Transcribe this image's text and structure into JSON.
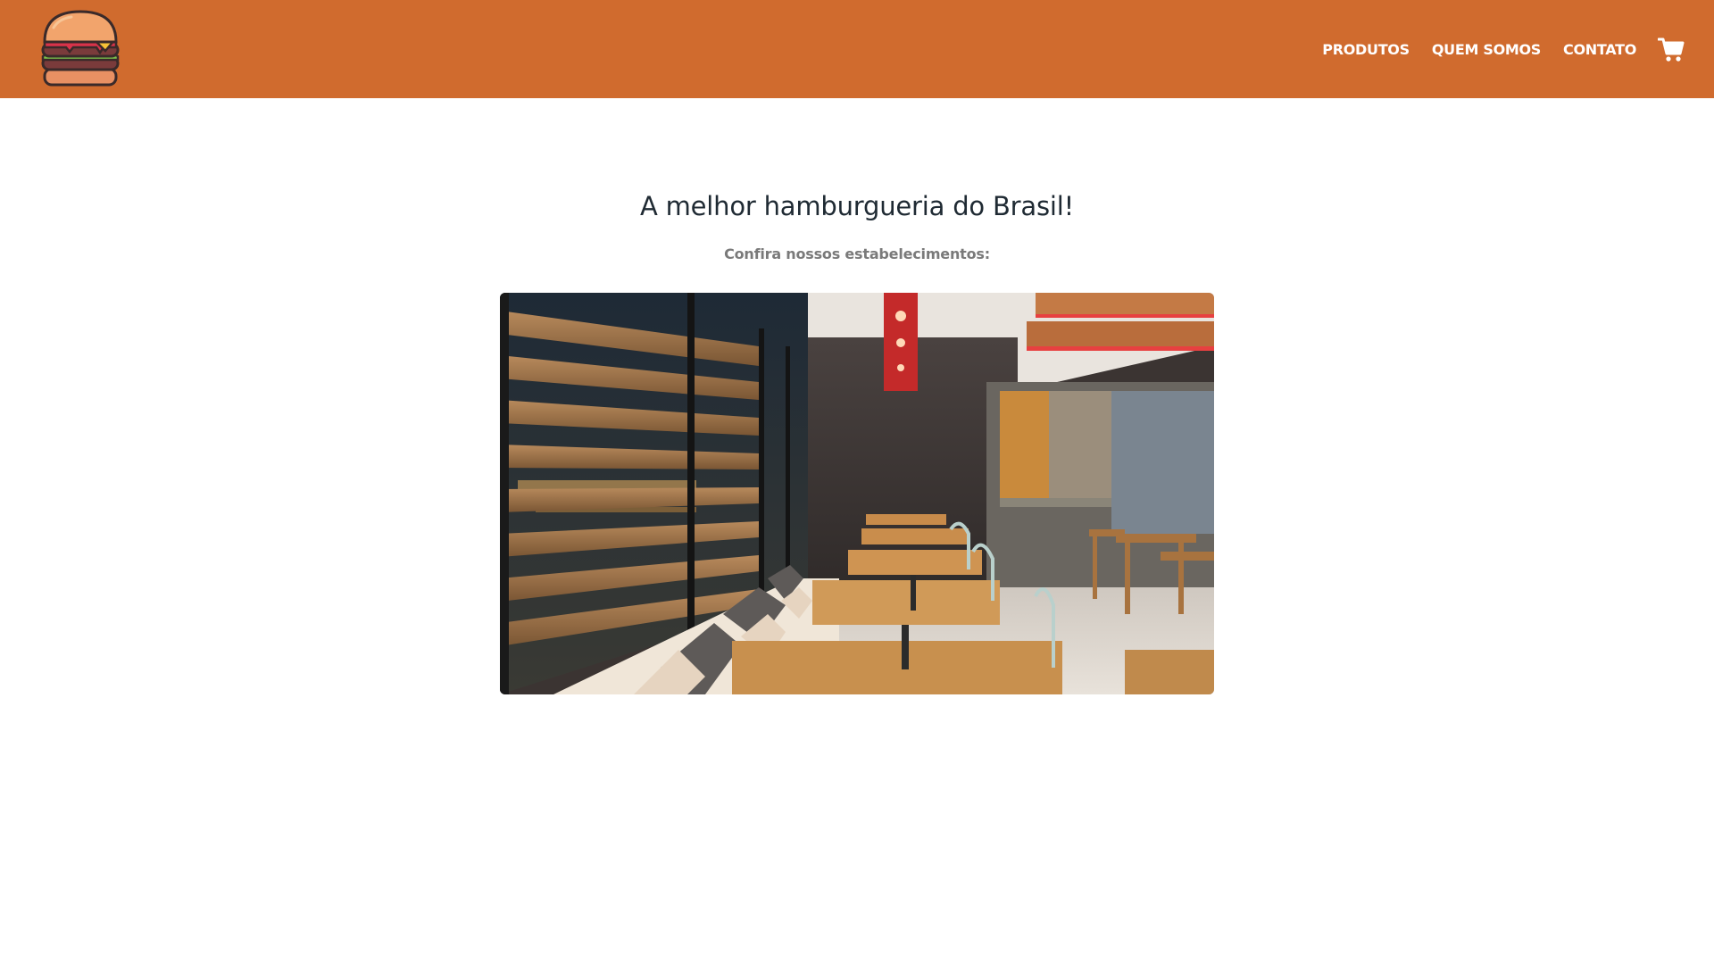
{
  "header": {
    "background_color": "#d06b2e",
    "logo_icon": "burger-icon",
    "nav": [
      {
        "label": "PRODUTOS"
      },
      {
        "label": "QUEM SOMOS"
      },
      {
        "label": "CONTATO"
      }
    ],
    "cart_icon": "shopping-cart-icon"
  },
  "main": {
    "title": "A melhor hamburgueria do Brasil!",
    "subtitle": "Confira nossos estabelecimentos:",
    "image": {
      "depicts": "restaurant-interior-photo"
    }
  }
}
